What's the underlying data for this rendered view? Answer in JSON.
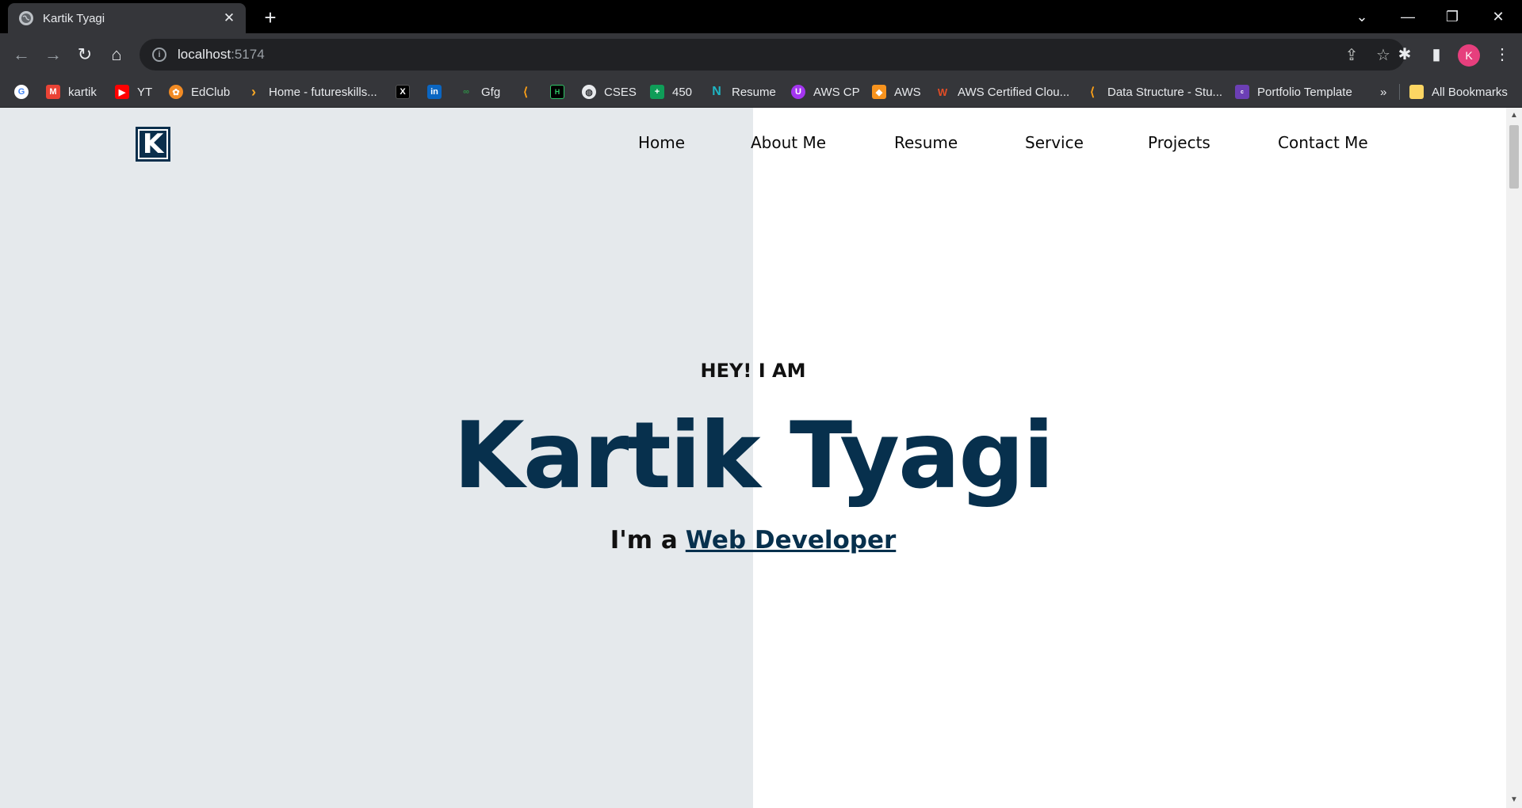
{
  "tab": {
    "title": "Kartik Tyagi",
    "close": "✕",
    "new": "+"
  },
  "window": {
    "dropdown": "⌄",
    "minimize": "—",
    "restore": "❐",
    "close": "✕"
  },
  "omnibox": {
    "host": "localhost",
    "port": ":5174"
  },
  "profile": {
    "initial": "K",
    "color": "#e63f7d"
  },
  "bookmarks": [
    {
      "label": "",
      "icon": "google-icon"
    },
    {
      "label": "kartik",
      "icon": "gmail-icon"
    },
    {
      "label": "YT",
      "icon": "youtube-icon"
    },
    {
      "label": "EdClub",
      "icon": "edclub-icon"
    },
    {
      "label": "Home - futureskills...",
      "icon": "chevron-icon"
    },
    {
      "label": "",
      "icon": "x-icon"
    },
    {
      "label": "",
      "icon": "linkedin-icon"
    },
    {
      "label": "Gfg",
      "icon": "gfg-icon"
    },
    {
      "label": "",
      "icon": "leetcode-icon"
    },
    {
      "label": "",
      "icon": "hackerrank-icon"
    },
    {
      "label": "CSES",
      "icon": "globe-icon"
    },
    {
      "label": "450",
      "icon": "sheets-icon"
    },
    {
      "label": "Resume",
      "icon": "novoresume-icon"
    },
    {
      "label": "AWS CP",
      "icon": "shield-icon"
    },
    {
      "label": "AWS",
      "icon": "aws-icon"
    },
    {
      "label": "AWS Certified Clou...",
      "icon": "udemy-icon"
    },
    {
      "label": "Data Structure - Stu...",
      "icon": "leetcode-icon"
    },
    {
      "label": "Portfolio Template",
      "icon": "colorlib-icon"
    }
  ],
  "bookmarks_more": "»",
  "all_bookmarks": "All Bookmarks",
  "site": {
    "logo_letter": "K",
    "nav": [
      "Home",
      "About Me",
      "Resume",
      "Service",
      "Projects",
      "Contact Me"
    ],
    "hero": {
      "greeting": "HEY! I AM",
      "name": "Kartik Tyagi",
      "prefix": "I'm a",
      "role": "Web Developer"
    },
    "colors": {
      "primary": "#07304d",
      "left_panel": "#e5e9ec",
      "background": "#ffffff"
    }
  }
}
